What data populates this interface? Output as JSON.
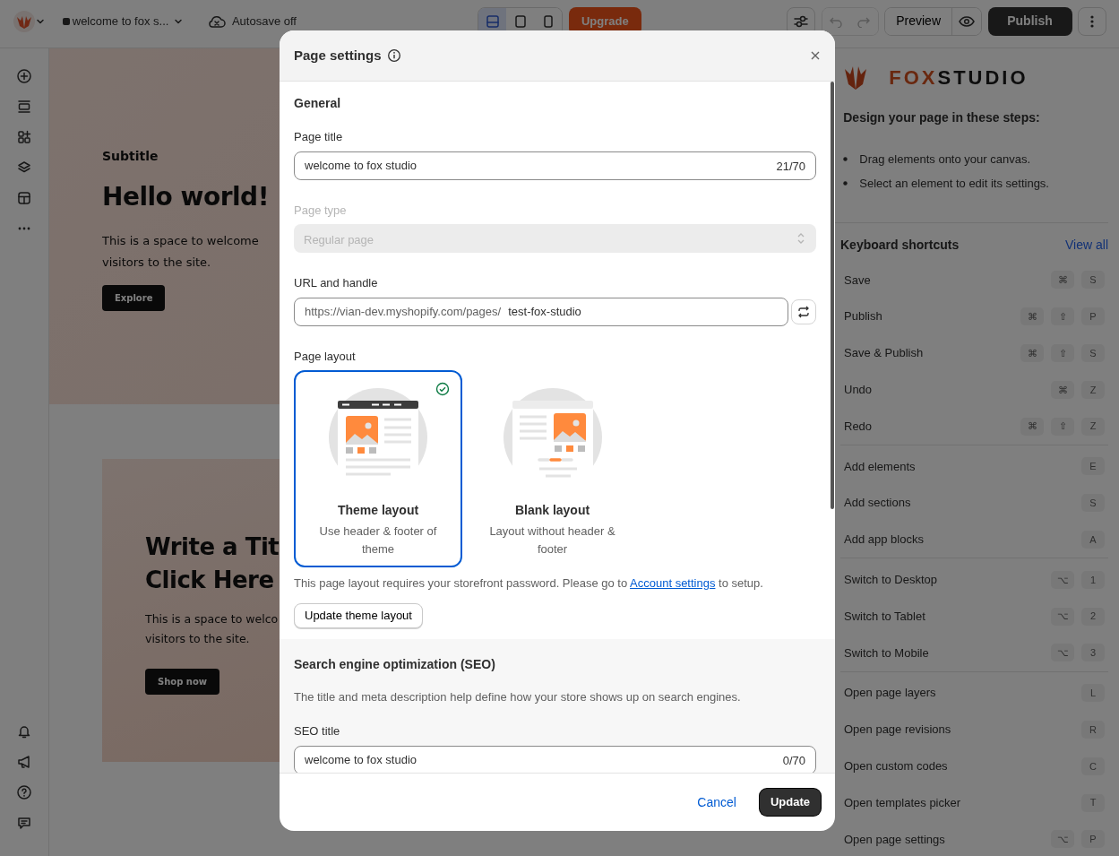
{
  "topbar": {
    "store_name": "welcome to fox s...",
    "autosave": "Autosave off",
    "devices": [
      {
        "kind": "desktop",
        "selected": true
      },
      {
        "kind": "tablet",
        "selected": false
      },
      {
        "kind": "mobile",
        "selected": false
      }
    ],
    "upgrade": "Upgrade",
    "preview": "Preview",
    "publish": "Publish"
  },
  "canvas": {
    "hero": {
      "subtitle": "Subtitle",
      "title": "Hello world!",
      "text_lines": [
        "This is a space to welcome",
        "visitors to the site."
      ],
      "button": "Explore"
    },
    "banner": {
      "title_lines": [
        "Write a Tit",
        "Click Here"
      ],
      "text_lines": [
        "This is a space to welco",
        "visitors to the site."
      ],
      "button": "Shop now"
    }
  },
  "right_panel": {
    "logo": [
      "FOX",
      "STUDIO"
    ],
    "steps_title": "Design your page in these steps:",
    "steps": [
      "Drag elements onto your canvas.",
      "Select an element to edit its settings."
    ],
    "shortcuts_title": "Keyboard shortcuts",
    "view_all": "View all",
    "groups": [
      [
        {
          "label": "Save",
          "keys": [
            "⌘",
            "S"
          ]
        },
        {
          "label": "Publish",
          "keys": [
            "⌘",
            "⇧",
            "P"
          ]
        },
        {
          "label": "Save & Publish",
          "keys": [
            "⌘",
            "⇧",
            "S"
          ]
        },
        {
          "label": "Undo",
          "keys": [
            "⌘",
            "Z"
          ]
        },
        {
          "label": "Redo",
          "keys": [
            "⌘",
            "⇧",
            "Z"
          ]
        }
      ],
      [
        {
          "label": "Add elements",
          "keys": [
            "E"
          ]
        },
        {
          "label": "Add sections",
          "keys": [
            "S"
          ]
        },
        {
          "label": "Add app blocks",
          "keys": [
            "A"
          ]
        }
      ],
      [
        {
          "label": "Switch to Desktop",
          "keys": [
            "⌥",
            "1"
          ]
        },
        {
          "label": "Switch to Tablet",
          "keys": [
            "⌥",
            "2"
          ]
        },
        {
          "label": "Switch to Mobile",
          "keys": [
            "⌥",
            "3"
          ]
        }
      ],
      [
        {
          "label": "Open page layers",
          "keys": [
            "L"
          ]
        },
        {
          "label": "Open page revisions",
          "keys": [
            "R"
          ]
        },
        {
          "label": "Open custom codes",
          "keys": [
            "C"
          ]
        },
        {
          "label": "Open templates picker",
          "keys": [
            "T"
          ]
        },
        {
          "label": "Open page settings",
          "keys": [
            "⌥",
            "P"
          ]
        }
      ]
    ]
  },
  "modal": {
    "title": "Page settings",
    "general_heading": "General",
    "page_title": {
      "label": "Page title",
      "value": "welcome to fox studio",
      "counter": "21/70"
    },
    "page_type": {
      "label": "Page type",
      "value": "Regular page",
      "disabled": true
    },
    "url": {
      "label": "URL and handle",
      "prefix": "https://vian-dev.myshopify.com/pages/",
      "value": "test-fox-studio"
    },
    "layout_label": "Page layout",
    "layouts": [
      {
        "kind": "theme",
        "title": "Theme layout",
        "description": "Use header & footer of theme",
        "selected": true
      },
      {
        "kind": "blank",
        "title": "Blank layout",
        "description": "Layout without header & footer",
        "selected": false
      }
    ],
    "note": {
      "before": "This page layout requires your storefront password. Please go to ",
      "link": "Account settings",
      "after": " to setup."
    },
    "update_theme_button": "Update theme layout",
    "seo": {
      "heading": "Search engine optimization (SEO)",
      "description": "The title and meta description help define how your store shows up on search engines.",
      "seo_title": {
        "label": "SEO title",
        "value": "welcome to fox studio",
        "counter": "0/70"
      }
    },
    "cancel": "Cancel",
    "update": "Update"
  }
}
